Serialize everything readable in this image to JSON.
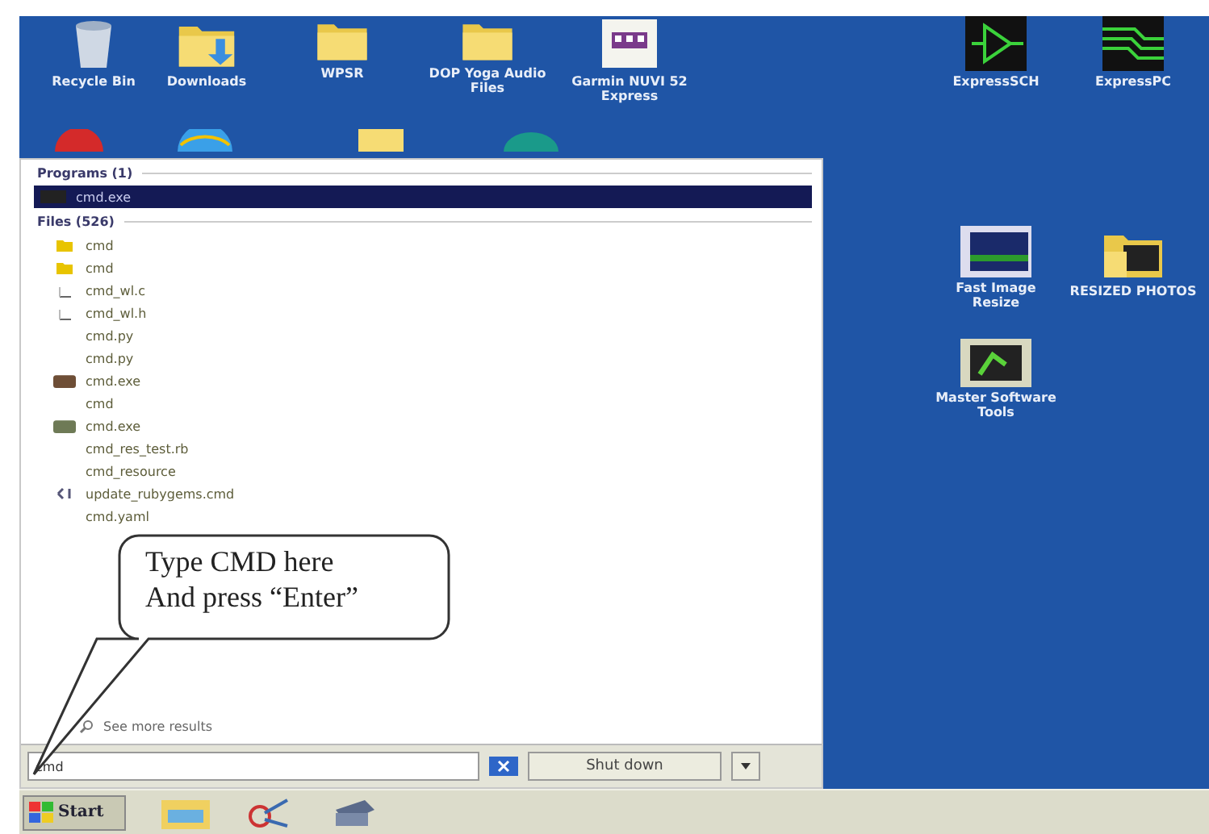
{
  "desktop": {
    "icons": [
      {
        "label": "Recycle Bin"
      },
      {
        "label": "Downloads"
      },
      {
        "label": "WPSR"
      },
      {
        "label": "DOP Yoga Audio Files"
      },
      {
        "label": "Garmin NUVI 52 Express"
      },
      {
        "label": "ExpressSCH"
      },
      {
        "label": "ExpressPC"
      },
      {
        "label": "Fast Image Resize"
      },
      {
        "label": "RESIZED PHOTOS"
      },
      {
        "label": "Master Software Tools"
      }
    ]
  },
  "start_menu": {
    "sections": [
      {
        "title": "Programs (1)",
        "items": [
          {
            "label": "cmd.exe",
            "selected": true
          }
        ]
      },
      {
        "title": "Files (526)",
        "items": [
          {
            "label": "cmd",
            "selected": false
          },
          {
            "label": "cmd",
            "selected": false
          },
          {
            "label": "cmd_wl.c",
            "selected": false
          },
          {
            "label": "cmd_wl.h",
            "selected": false
          },
          {
            "label": "cmd.py",
            "selected": false
          },
          {
            "label": "cmd.py",
            "selected": false
          },
          {
            "label": "cmd.exe",
            "selected": false
          },
          {
            "label": "cmd",
            "selected": false
          },
          {
            "label": "cmd.exe",
            "selected": false
          },
          {
            "label": "cmd_res_test.rb",
            "selected": false
          },
          {
            "label": "cmd_resource",
            "selected": false
          },
          {
            "label": "update_rubygems.cmd",
            "selected": false
          },
          {
            "label": "cmd.yaml",
            "selected": false
          }
        ]
      }
    ],
    "see_more": "See more results",
    "search": {
      "value": "cmd"
    },
    "shutdown": "Shut down"
  },
  "callout": {
    "lines": [
      "Type CMD here",
      "And press “Enter”"
    ]
  },
  "taskbar": {
    "start": "Start"
  }
}
